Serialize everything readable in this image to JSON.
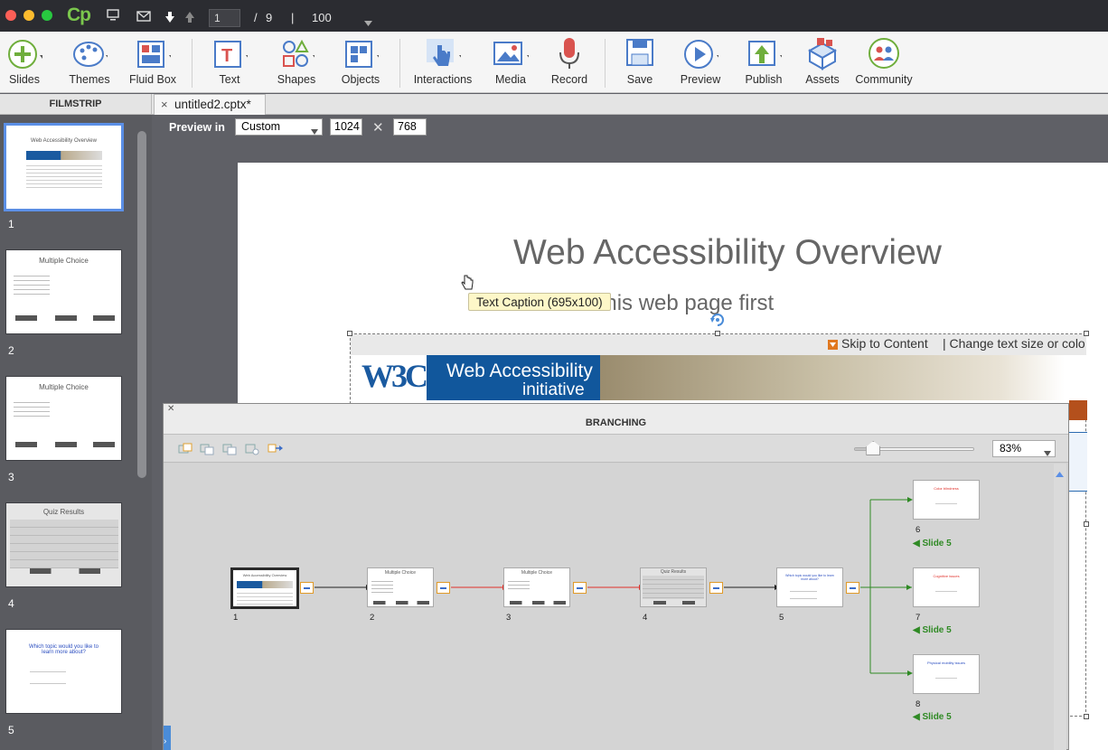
{
  "titlebar": {
    "app_logo": "Cp",
    "page_current": "1",
    "page_separator": "/",
    "page_total": "9",
    "divider": "|",
    "zoom": "100"
  },
  "toolbar": {
    "items": [
      {
        "label": "Slides",
        "icon": "plus-circle-icon"
      },
      {
        "label": "Themes",
        "icon": "palette-icon"
      },
      {
        "label": "Fluid Box",
        "icon": "fluid-box-icon"
      },
      {
        "label": "Text",
        "icon": "text-icon"
      },
      {
        "label": "Shapes",
        "icon": "shapes-icon"
      },
      {
        "label": "Objects",
        "icon": "objects-icon"
      },
      {
        "label": "Interactions",
        "icon": "hand-pointer-icon"
      },
      {
        "label": "Media",
        "icon": "image-icon"
      },
      {
        "label": "Record",
        "icon": "microphone-icon"
      },
      {
        "label": "Save",
        "icon": "floppy-icon"
      },
      {
        "label": "Preview",
        "icon": "play-icon"
      },
      {
        "label": "Publish",
        "icon": "publish-icon"
      },
      {
        "label": "Assets",
        "icon": "assets-icon"
      },
      {
        "label": "Community",
        "icon": "community-icon"
      }
    ]
  },
  "filmstrip": {
    "header": "FILMSTRIP",
    "slides": [
      {
        "num": "1",
        "title": "Web Accessibility Overview"
      },
      {
        "num": "2",
        "title": "Multiple Choice"
      },
      {
        "num": "3",
        "title": "Multiple Choice"
      },
      {
        "num": "4",
        "title": "Quiz Results"
      },
      {
        "num": "5",
        "title": "Which topic would you like to learn more about?"
      }
    ]
  },
  "document": {
    "tab_title": "untitled2.cptx*",
    "preview_label": "Preview in",
    "preview_mode": "Custom",
    "width": "1024",
    "height": "768"
  },
  "slide": {
    "title": "Web Accessibility Overview",
    "subtitle": "Review this web page first",
    "subtitle_visible": "iew this web page first",
    "caption_tooltip": "Text Caption (695x100)",
    "web_skip": "Skip to Content",
    "web_textsize": "| Change text size or colo",
    "banner_logo": "W3C",
    "banner_line1": "Web Accessibility",
    "banner_line2": "initiative"
  },
  "branching": {
    "title": "BRANCHING",
    "zoom_value": "83%",
    "zoom_fraction": 0.16,
    "nodes": [
      {
        "num": "1"
      },
      {
        "num": "2"
      },
      {
        "num": "3"
      },
      {
        "num": "4"
      },
      {
        "num": "5"
      },
      {
        "num": "6",
        "link": "Slide 5"
      },
      {
        "num": "7",
        "link": "Slide 5"
      },
      {
        "num": "8",
        "link": "Slide 5"
      }
    ],
    "thumb_texts": {
      "n6": "Color blindness",
      "n7": "Cognitive issues",
      "n8": "Physical mobility issues"
    }
  },
  "colors": {
    "accent_blue": "#5b8fe6",
    "success_path": "#2f8a24",
    "failure_path": "#e0302a",
    "app_green": "#7bc74d"
  }
}
